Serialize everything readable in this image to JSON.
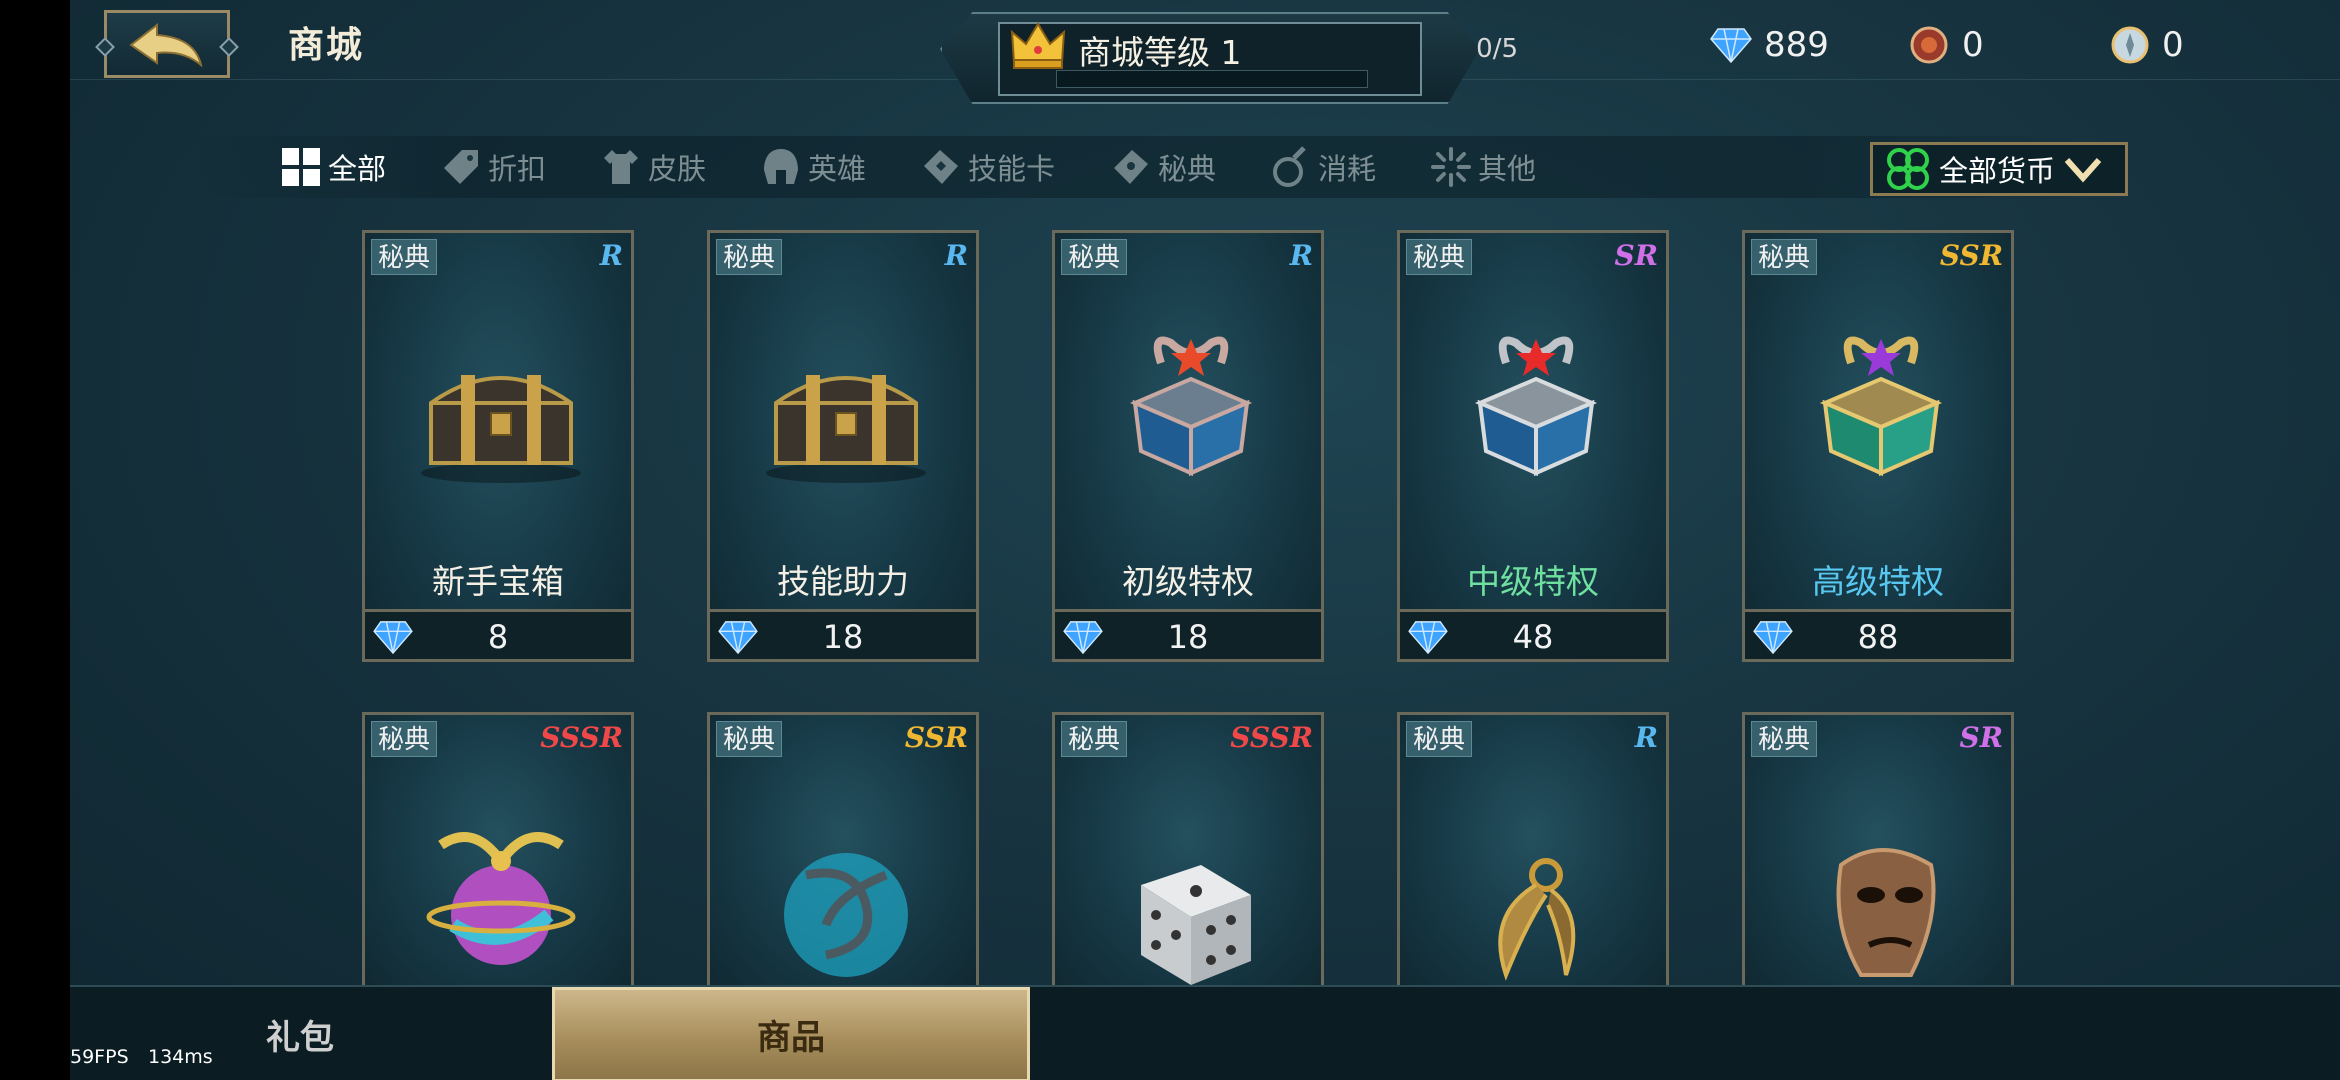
{
  "header": {
    "title": "商城",
    "level_label": "商城等级 1",
    "level_progress": "0/5",
    "progress_fraction": 0,
    "currencies": [
      {
        "icon": "diamond-icon",
        "value": "889"
      },
      {
        "icon": "token-icon",
        "value": "0"
      },
      {
        "icon": "coin-icon",
        "value": "0"
      }
    ]
  },
  "tabs": [
    {
      "label": "全部",
      "icon": "grid-icon",
      "active": true
    },
    {
      "label": "折扣",
      "icon": "price-tag-icon",
      "active": false
    },
    {
      "label": "皮肤",
      "icon": "shirt-icon",
      "active": false
    },
    {
      "label": "英雄",
      "icon": "helmet-icon",
      "active": false
    },
    {
      "label": "技能卡",
      "icon": "card-icon",
      "active": false
    },
    {
      "label": "秘典",
      "icon": "book-icon",
      "active": false
    },
    {
      "label": "消耗",
      "icon": "potion-icon",
      "active": false
    },
    {
      "label": "其他",
      "icon": "sparkle-icon",
      "active": false
    }
  ],
  "currency_filter": {
    "label": "全部货币",
    "icon": "clover-icon"
  },
  "cards": [
    {
      "tag": "秘典",
      "rarity": "R",
      "name": "新手宝箱",
      "price": "8",
      "art": "chest-icon",
      "name_color": "#f4f0e6"
    },
    {
      "tag": "秘典",
      "rarity": "R",
      "name": "技能助力",
      "price": "18",
      "art": "chest-icon",
      "name_color": "#f4f0e6"
    },
    {
      "tag": "秘典",
      "rarity": "R",
      "name": "初级特权",
      "price": "18",
      "art": "privilege-box-icon",
      "name_color": "#f4f0e6"
    },
    {
      "tag": "秘典",
      "rarity": "SR",
      "name": "中级特权",
      "price": "48",
      "art": "privilege-box-icon",
      "name_color": "#6fe0a0"
    },
    {
      "tag": "秘典",
      "rarity": "SSR",
      "name": "高级特权",
      "price": "88",
      "art": "privilege-box-icon",
      "name_color": "#58c8f0"
    },
    {
      "tag": "秘典",
      "rarity": "SSSR",
      "name": "",
      "price": "",
      "art": "orb-icon"
    },
    {
      "tag": "秘典",
      "rarity": "SSR",
      "name": "",
      "price": "",
      "art": "ring-icon"
    },
    {
      "tag": "秘典",
      "rarity": "SSSR",
      "name": "",
      "price": "",
      "art": "dice-icon"
    },
    {
      "tag": "秘典",
      "rarity": "R",
      "name": "",
      "price": "",
      "art": "earring-icon"
    },
    {
      "tag": "秘典",
      "rarity": "SR",
      "name": "",
      "price": "",
      "art": "mask-icon"
    }
  ],
  "rarity_colors": {
    "R": "#59b8f0",
    "SR": "#d070e8",
    "SSR": "#f0b830",
    "SSSR": "#f04848"
  },
  "bottom_tabs": [
    {
      "label": "礼包",
      "active": false
    },
    {
      "label": "商品",
      "active": true
    }
  ],
  "debug": {
    "fps": "59FPS",
    "latency": "134ms"
  }
}
